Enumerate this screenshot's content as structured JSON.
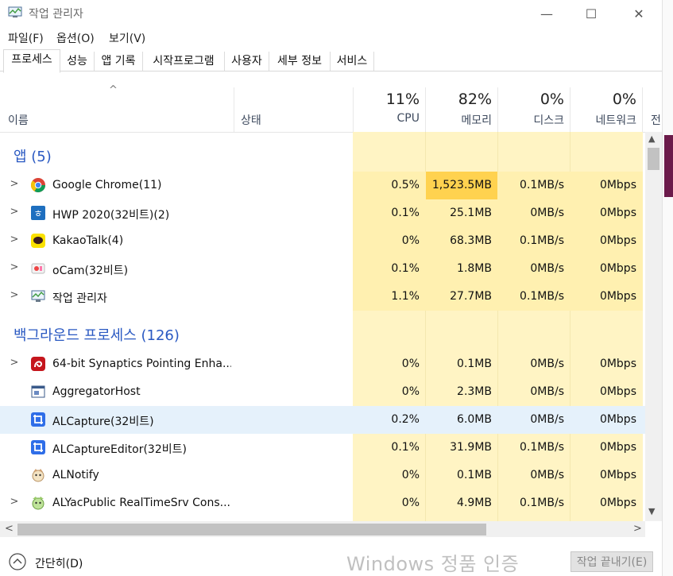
{
  "window": {
    "title": "작업 관리자",
    "minimize": "—",
    "maximize": "☐",
    "close": "✕"
  },
  "menu": [
    "파일(F)",
    "옵션(O)",
    "보기(V)"
  ],
  "tabs": [
    "프로세스",
    "성능",
    "앱 기록",
    "시작프로그램",
    "사용자",
    "세부 정보",
    "서비스"
  ],
  "columns": {
    "name": "이름",
    "status": "상태",
    "cpu": {
      "pct": "11%",
      "label": "CPU"
    },
    "memory": {
      "pct": "82%",
      "label": "메모리"
    },
    "disk": {
      "pct": "0%",
      "label": "디스크"
    },
    "network": {
      "pct": "0%",
      "label": "네트워크"
    },
    "power": "전"
  },
  "groups": {
    "apps": {
      "title": "앱 (5)"
    },
    "background": {
      "title": "백그라운드 프로세스 (126)"
    }
  },
  "apps": [
    {
      "name": "Google Chrome(11)",
      "cpu": "0.5%",
      "mem": "1,523.5MB",
      "disk": "0.1MB/s",
      "net": "0Mbps",
      "icon": "chrome-icon"
    },
    {
      "name": "HWP 2020(32비트)(2)",
      "cpu": "0.1%",
      "mem": "25.1MB",
      "disk": "0MB/s",
      "net": "0Mbps",
      "icon": "hwp-icon"
    },
    {
      "name": "KakaoTalk(4)",
      "cpu": "0%",
      "mem": "68.3MB",
      "disk": "0.1MB/s",
      "net": "0Mbps",
      "icon": "kakaotalk-icon"
    },
    {
      "name": "oCam(32비트)",
      "cpu": "0.1%",
      "mem": "1.8MB",
      "disk": "0MB/s",
      "net": "0Mbps",
      "icon": "ocam-icon"
    },
    {
      "name": "작업 관리자",
      "cpu": "1.1%",
      "mem": "27.7MB",
      "disk": "0.1MB/s",
      "net": "0Mbps",
      "icon": "task-manager-icon"
    }
  ],
  "background": [
    {
      "name": "64-bit Synaptics Pointing Enha...",
      "cpu": "0%",
      "mem": "0.1MB",
      "disk": "0MB/s",
      "net": "0Mbps",
      "icon": "synaptics-icon"
    },
    {
      "name": "AggregatorHost",
      "cpu": "0%",
      "mem": "2.3MB",
      "disk": "0MB/s",
      "net": "0Mbps",
      "icon": "window-app-icon"
    },
    {
      "name": "ALCapture(32비트)",
      "cpu": "0.2%",
      "mem": "6.0MB",
      "disk": "0MB/s",
      "net": "0Mbps",
      "icon": "alcapture-icon"
    },
    {
      "name": "ALCaptureEditor(32비트)",
      "cpu": "0.1%",
      "mem": "31.9MB",
      "disk": "0.1MB/s",
      "net": "0Mbps",
      "icon": "alcapture-editor-icon"
    },
    {
      "name": "ALNotify",
      "cpu": "0%",
      "mem": "0.1MB",
      "disk": "0MB/s",
      "net": "0Mbps",
      "icon": "alnotify-icon"
    },
    {
      "name": "ALYacPublic RealTimeSrv Cons...",
      "cpu": "0%",
      "mem": "4.9MB",
      "disk": "0.1MB/s",
      "net": "0Mbps",
      "icon": "alyac-icon"
    }
  ],
  "footer": {
    "fewer_details": "간단히(D)",
    "end_task": "작업 끝내기(E)",
    "watermark": "Windows 정품 인증"
  },
  "colors": {
    "accent": "#2a59c2",
    "heat_light": "#fff4c4",
    "heat_strong": "#ffd24f",
    "selected_row": "#e5f1fb"
  }
}
